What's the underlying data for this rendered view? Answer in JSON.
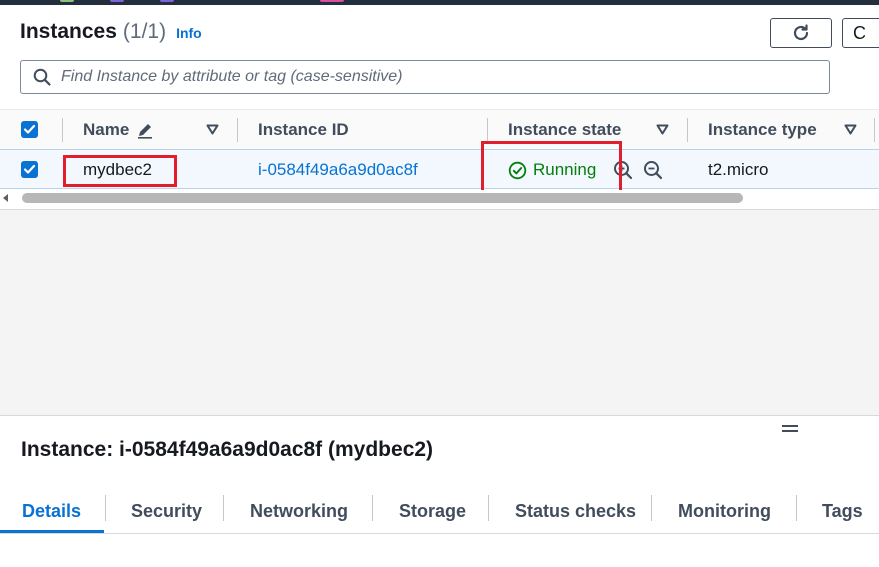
{
  "header": {
    "title": "Instances",
    "count": "(1/1)",
    "info_link": "Info"
  },
  "toolbar": {
    "refresh_icon": "refresh-icon",
    "actions_partial": "C"
  },
  "search": {
    "placeholder": "Find Instance by attribute or tag (case-sensitive)",
    "icon": "search-icon"
  },
  "table": {
    "columns": [
      {
        "label": "Name",
        "icon": "pencil-icon"
      },
      {
        "label": "Instance ID"
      },
      {
        "label": "Instance state"
      },
      {
        "label": "Instance type"
      }
    ],
    "rows": [
      {
        "selected": true,
        "name": "mydbec2",
        "instance_id": "i-0584f49a6a9d0ac8f",
        "state": "Running",
        "type": "t2.micro"
      }
    ]
  },
  "details": {
    "title": "Instance: i-0584f49a6a9d0ac8f (mydbec2)",
    "tabs": [
      {
        "label": "Details",
        "active": true
      },
      {
        "label": "Security"
      },
      {
        "label": "Networking"
      },
      {
        "label": "Storage"
      },
      {
        "label": "Status checks"
      },
      {
        "label": "Monitoring"
      },
      {
        "label": "Tags"
      }
    ]
  },
  "colors": {
    "accent": "#0972d3",
    "running": "#037f0c",
    "highlight": "#e01e2d"
  }
}
